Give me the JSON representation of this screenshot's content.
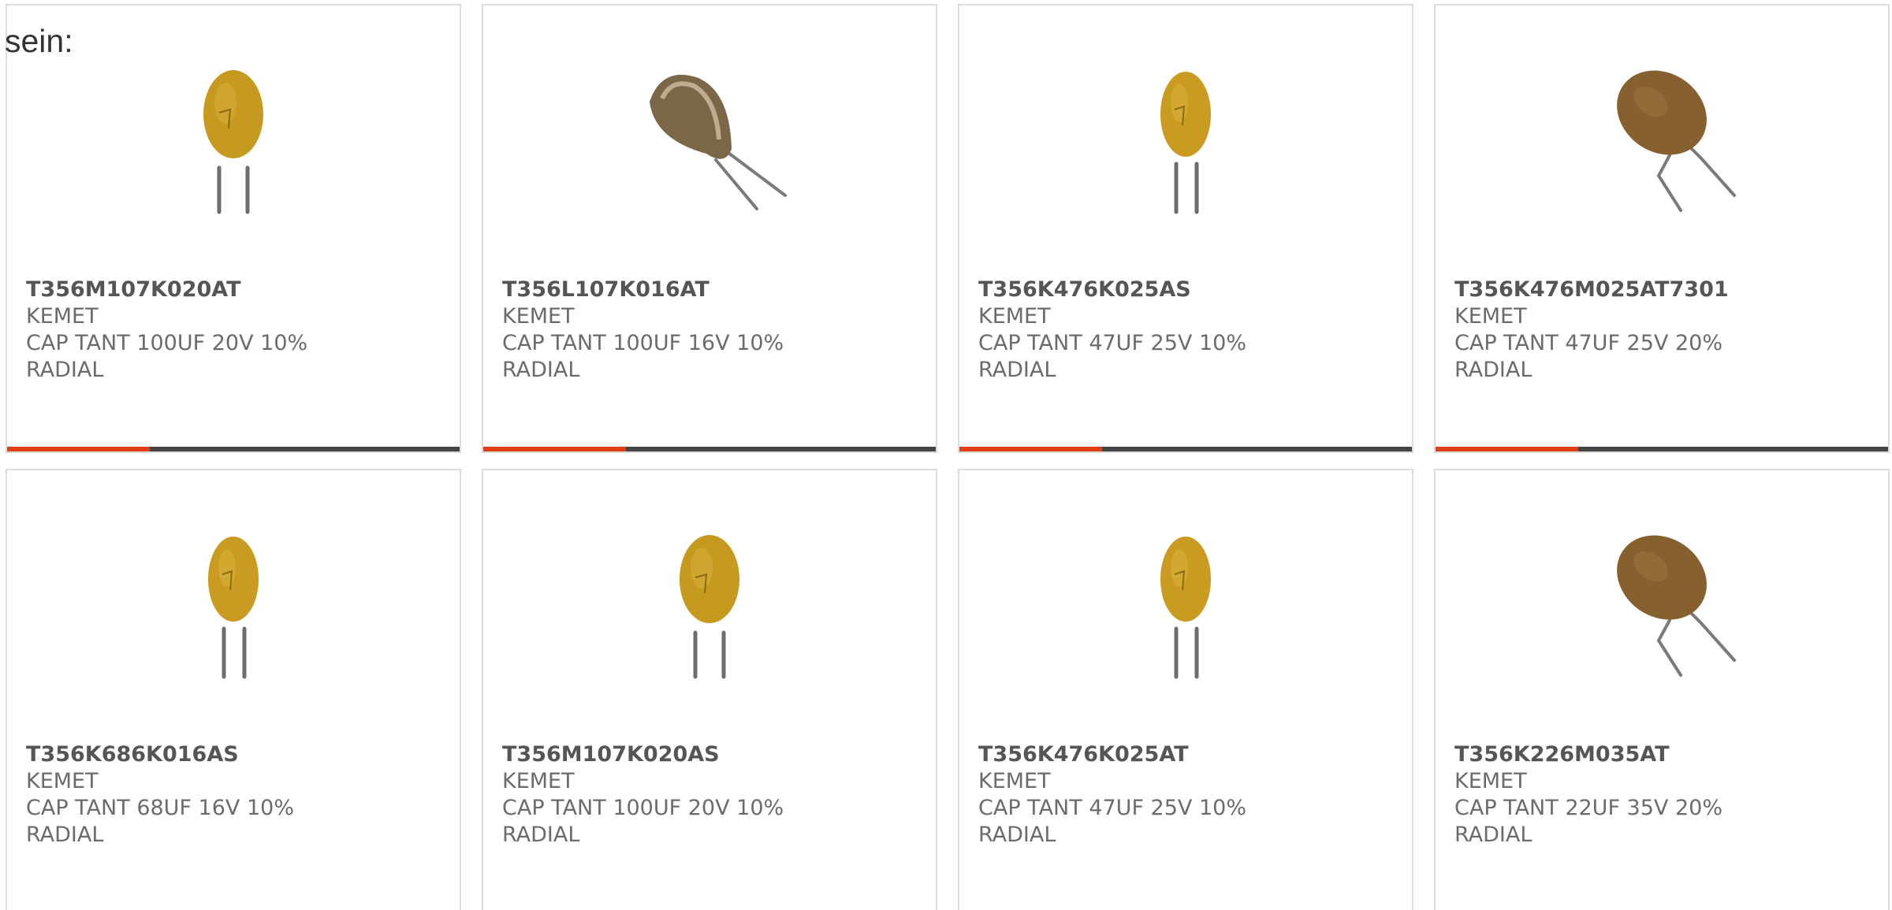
{
  "intro_text": "sein:",
  "colors": {
    "accent": "#e23e16",
    "bar": "#444444",
    "border": "#dcdcdc"
  },
  "products": [
    {
      "part_number": "T356M107K020AT",
      "manufacturer": "KEMET",
      "description_1": "CAP TANT 100UF 20V 10%",
      "description_2": "RADIAL",
      "image_style": "upright-yellow",
      "has_accent_bar": true
    },
    {
      "part_number": "T356L107K016AT",
      "manufacturer": "KEMET",
      "description_1": "CAP TANT 100UF 16V 10%",
      "description_2": "RADIAL",
      "image_style": "tilted-dark",
      "has_accent_bar": true
    },
    {
      "part_number": "T356K476K025AS",
      "manufacturer": "KEMET",
      "description_1": "CAP TANT 47UF 25V 10%",
      "description_2": "RADIAL",
      "image_style": "upright-yellow-small",
      "has_accent_bar": true
    },
    {
      "part_number": "T356K476M025AT7301",
      "manufacturer": "KEMET",
      "description_1": "CAP TANT 47UF 25V 20%",
      "description_2": "RADIAL",
      "image_style": "tilted-brown",
      "has_accent_bar": true
    },
    {
      "part_number": "T356K686K016AS",
      "manufacturer": "KEMET",
      "description_1": "CAP TANT 68UF 16V 10%",
      "description_2": "RADIAL",
      "image_style": "upright-yellow-small",
      "has_accent_bar": false
    },
    {
      "part_number": "T356M107K020AS",
      "manufacturer": "KEMET",
      "description_1": "CAP TANT 100UF 20V 10%",
      "description_2": "RADIAL",
      "image_style": "upright-yellow",
      "has_accent_bar": false
    },
    {
      "part_number": "T356K476K025AT",
      "manufacturer": "KEMET",
      "description_1": "CAP TANT 47UF 25V 10%",
      "description_2": "RADIAL",
      "image_style": "upright-yellow-small",
      "has_accent_bar": false
    },
    {
      "part_number": "T356K226M035AT",
      "manufacturer": "KEMET",
      "description_1": "CAP TANT 22UF 35V 20%",
      "description_2": "RADIAL",
      "image_style": "tilted-brown",
      "has_accent_bar": false
    }
  ]
}
